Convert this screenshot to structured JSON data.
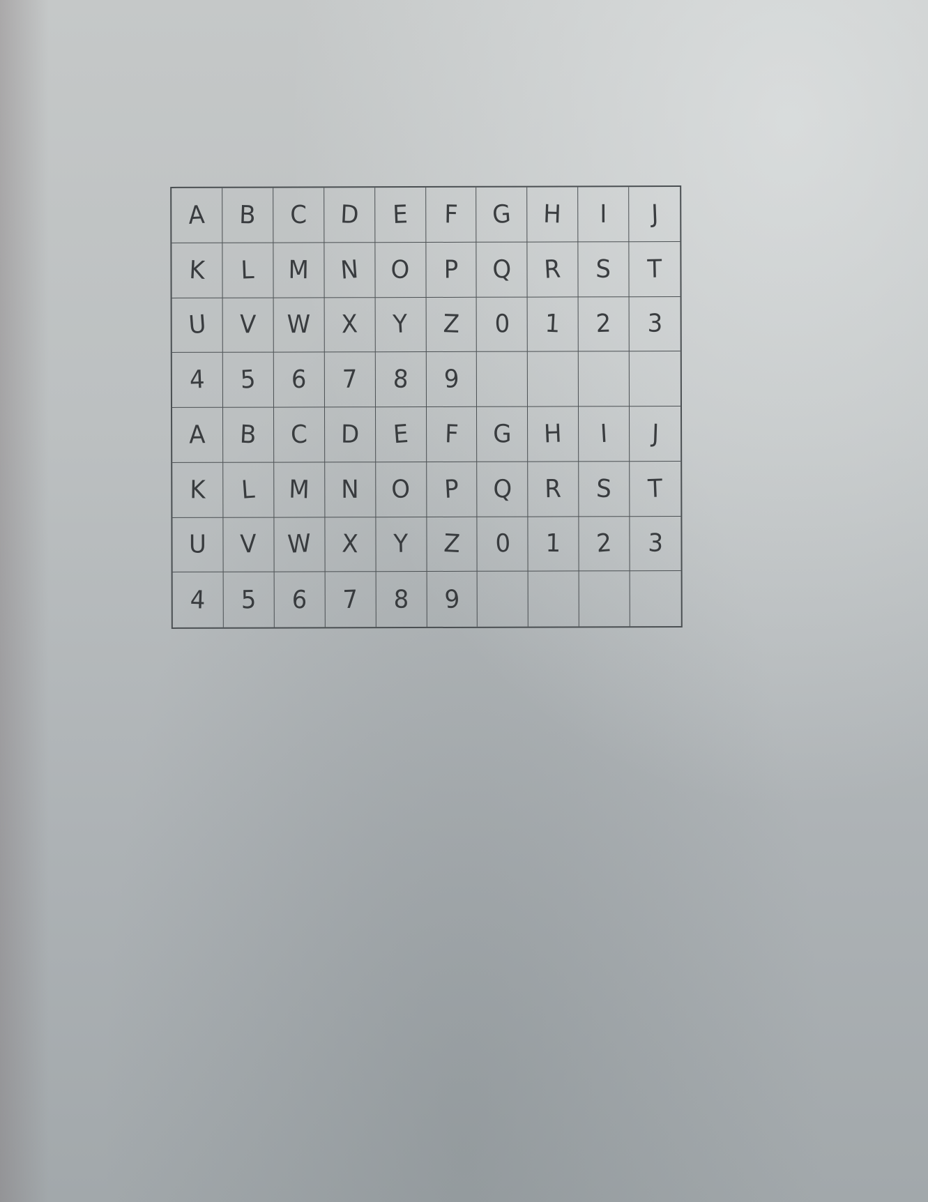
{
  "grid": {
    "rows": [
      [
        "A",
        "B",
        "C",
        "D",
        "E",
        "F",
        "G",
        "H",
        "I",
        "J"
      ],
      [
        "K",
        "L",
        "M",
        "N",
        "O",
        "P",
        "Q",
        "R",
        "S",
        "T"
      ],
      [
        "U",
        "V",
        "W",
        "X",
        "Y",
        "Z",
        "0",
        "1",
        "2",
        "3"
      ],
      [
        "4",
        "5",
        "6",
        "7",
        "8",
        "9",
        "",
        "",
        "",
        ""
      ],
      [
        "A",
        "B",
        "C",
        "D",
        "E",
        "F",
        "G",
        "H",
        "I",
        "J"
      ],
      [
        "K",
        "L",
        "M",
        "N",
        "O",
        "P",
        "Q",
        "R",
        "S",
        "T"
      ],
      [
        "U",
        "V",
        "W",
        "X",
        "Y",
        "Z",
        "0",
        "1",
        "2",
        "3"
      ],
      [
        "4",
        "5",
        "6",
        "7",
        "8",
        "9",
        "",
        "",
        "",
        ""
      ]
    ]
  }
}
